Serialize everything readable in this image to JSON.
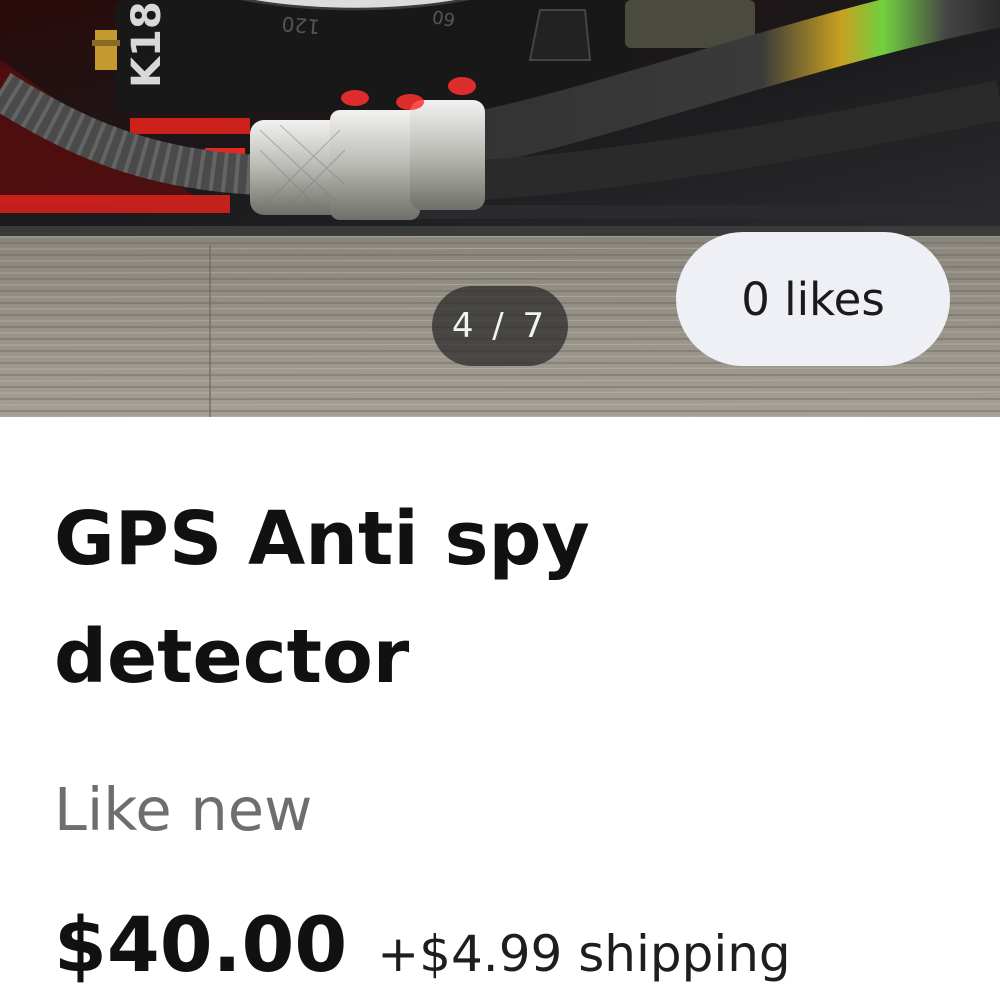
{
  "photo": {
    "counter": "4 / 7",
    "likes_label": "0 likes",
    "device_label": "K18",
    "dial_text_1": "60",
    "dial_text_2": "120"
  },
  "listing": {
    "title": "GPS Anti spy detector",
    "condition": "Like new",
    "price": "$40.00",
    "shipping": "+$4.99 shipping"
  },
  "colors": {
    "accent_red": "#e0221c",
    "pill_light": "#eef0f5",
    "pill_dark": "#282828"
  }
}
